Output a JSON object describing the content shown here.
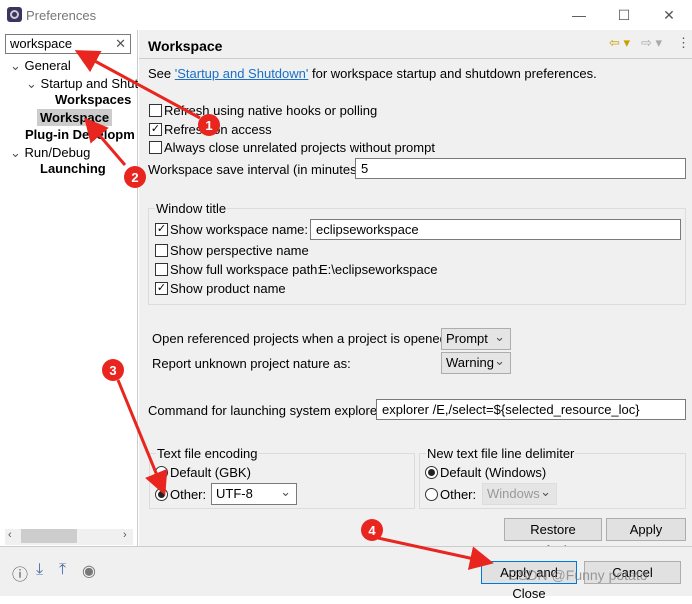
{
  "window": {
    "title": "Preferences",
    "controls": [
      "—",
      "☐",
      "✕"
    ]
  },
  "search": {
    "value": "workspace",
    "clear": "✕"
  },
  "tree": [
    {
      "label": "General",
      "chev": "⌄",
      "bold": false
    },
    {
      "label": "Startup and Shut",
      "chev": "⌄",
      "bold": false
    },
    {
      "label": "Workspaces",
      "bold": true
    },
    {
      "label": "Workspace",
      "bold": true,
      "selected": true
    },
    {
      "label": "Plug-in Developme",
      "bold": true
    },
    {
      "label": "Run/Debug",
      "chev": "⌄",
      "bold": false
    },
    {
      "label": "Launching",
      "bold": true
    }
  ],
  "page": {
    "title": "Workspace",
    "see_prefix": "See ",
    "see_link": "'Startup and Shutdown'",
    "see_suffix": " for workspace startup and shutdown preferences.",
    "opt_native": "Refresh using native hooks or polling",
    "opt_access": "Refresh on access",
    "opt_close": "Always close unrelated projects without prompt",
    "save_interval_label": "Workspace save interval (in minutes):",
    "save_interval_value": "5",
    "window_title": {
      "legend": "Window title",
      "show_ws_name": "Show workspace name:",
      "ws_name_value": "eclipseworkspace",
      "show_persp": "Show perspective name",
      "show_path": "Show full workspace path:",
      "path_value": "E:\\eclipseworkspace",
      "show_product": "Show product name"
    },
    "open_ref_label": "Open referenced projects when a project is opened:",
    "open_ref_value": "Prompt",
    "unknown_nature_label": "Report unknown project nature as:",
    "unknown_nature_value": "Warning",
    "explorer_label": "Command for launching system explorer:",
    "explorer_value": "explorer /E,/select=${selected_resource_loc}",
    "encoding": {
      "legend": "Text file encoding",
      "default": "Default (GBK)",
      "other": "Other:",
      "value": "UTF-8"
    },
    "delimiter": {
      "legend": "New text file line delimiter",
      "default": "Default (Windows)",
      "other": "Other:",
      "value": "Windows"
    },
    "restore": "Restore Defaults",
    "apply": "Apply"
  },
  "footer": {
    "apply_close": "Apply and Close",
    "cancel": "Cancel"
  },
  "annotations": {
    "n1": "1",
    "n2": "2",
    "n3": "3",
    "n4": "4",
    "color": "#e8261f"
  },
  "watermark": "CSDN @Funny potato"
}
